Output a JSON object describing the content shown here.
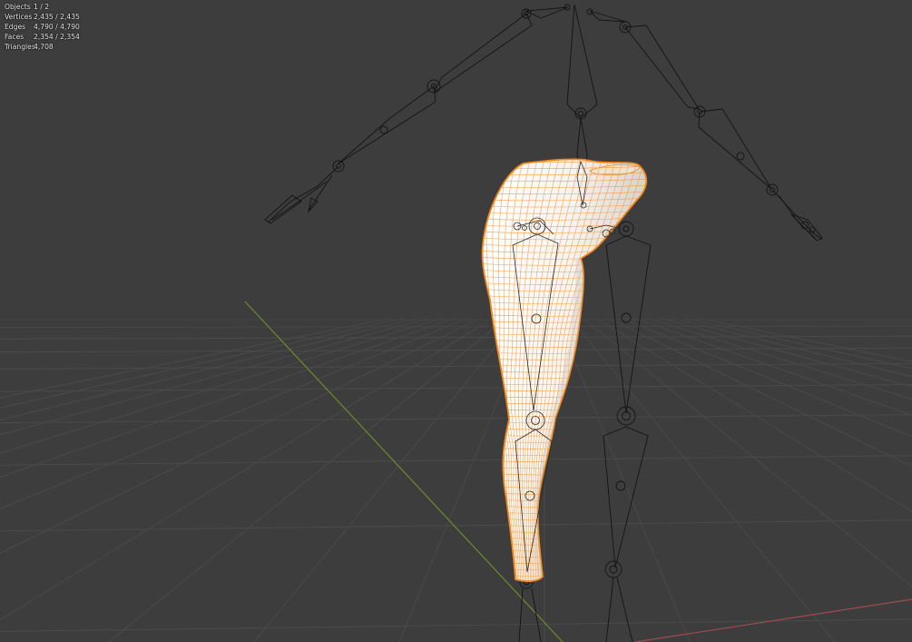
{
  "viewport": {
    "background": "#3d3d3d",
    "grid_color": "#4a4a4a",
    "x_axis_color": "#a04a52",
    "y_axis_color": "#6f8a2c",
    "armature_color": "#141414",
    "selection_outline": "#f0861a",
    "mesh_fill": "#f4f1ee",
    "wire_color": "#f39a3c"
  },
  "statistics": [
    {
      "label": "Objects",
      "value": "1 / 2"
    },
    {
      "label": "Vertices",
      "value": "2,435 / 2,435"
    },
    {
      "label": "Edges",
      "value": "4,790 / 4,790"
    },
    {
      "label": "Faces",
      "value": "2,354 / 2,354"
    },
    {
      "label": "Triangles",
      "value": "4,708"
    }
  ]
}
